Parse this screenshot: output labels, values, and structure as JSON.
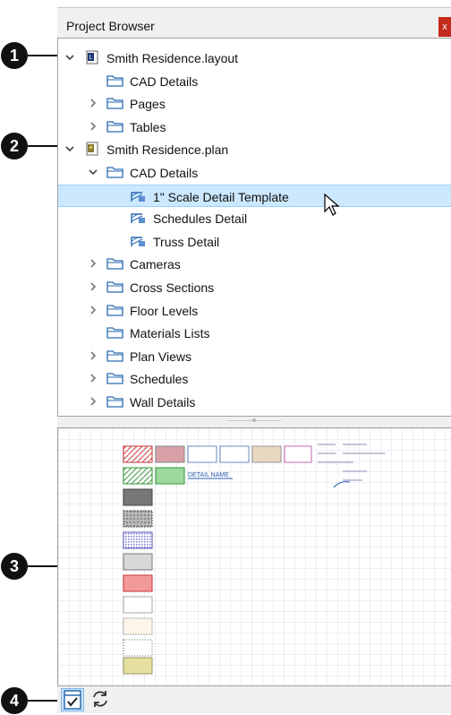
{
  "panel": {
    "title": "Project Browser",
    "close_glyph": "x"
  },
  "tree": [
    {
      "label": "Smith Residence.layout",
      "indent": 0,
      "chevron": "expanded",
      "icon": "layout-file-icon"
    },
    {
      "label": "CAD Details",
      "indent": 1,
      "chevron": "none",
      "icon": "folder-icon"
    },
    {
      "label": "Pages",
      "indent": 1,
      "chevron": "collapsed",
      "icon": "folder-icon"
    },
    {
      "label": "Tables",
      "indent": 1,
      "chevron": "collapsed",
      "icon": "folder-icon"
    },
    {
      "label": "Smith Residence.plan",
      "indent": 0,
      "chevron": "expanded",
      "icon": "plan-file-icon"
    },
    {
      "label": "CAD Details",
      "indent": 1,
      "chevron": "expanded",
      "icon": "folder-icon"
    },
    {
      "label": "1\" Scale Detail Template",
      "indent": 2,
      "chevron": "none",
      "icon": "cad-detail-icon",
      "selected": true
    },
    {
      "label": "Schedules Detail",
      "indent": 2,
      "chevron": "none",
      "icon": "cad-detail-icon"
    },
    {
      "label": "Truss Detail",
      "indent": 2,
      "chevron": "none",
      "icon": "cad-detail-icon"
    },
    {
      "label": "Cameras",
      "indent": 1,
      "chevron": "collapsed",
      "icon": "folder-icon"
    },
    {
      "label": "Cross Sections",
      "indent": 1,
      "chevron": "collapsed",
      "icon": "folder-icon"
    },
    {
      "label": "Floor Levels",
      "indent": 1,
      "chevron": "collapsed",
      "icon": "folder-icon"
    },
    {
      "label": "Materials Lists",
      "indent": 1,
      "chevron": "none",
      "icon": "folder-icon"
    },
    {
      "label": "Plan Views",
      "indent": 1,
      "chevron": "collapsed",
      "icon": "folder-icon"
    },
    {
      "label": "Schedules",
      "indent": 1,
      "chevron": "collapsed",
      "icon": "folder-icon"
    },
    {
      "label": "Wall Details",
      "indent": 1,
      "chevron": "collapsed",
      "icon": "folder-icon"
    }
  ],
  "preview": {
    "detail_name_text": "DETAIL NAME"
  },
  "toolbar": {
    "buttons": [
      {
        "icon": "preview-toggle-icon",
        "active": true
      },
      {
        "icon": "refresh-icon",
        "active": false
      }
    ]
  },
  "callouts": [
    "1",
    "2",
    "3",
    "4"
  ],
  "colors": {
    "selection": "#cce8ff",
    "folder_stroke": "#2a6bb0",
    "callout_bg": "#111111",
    "close_bg": "#c42b1c"
  }
}
